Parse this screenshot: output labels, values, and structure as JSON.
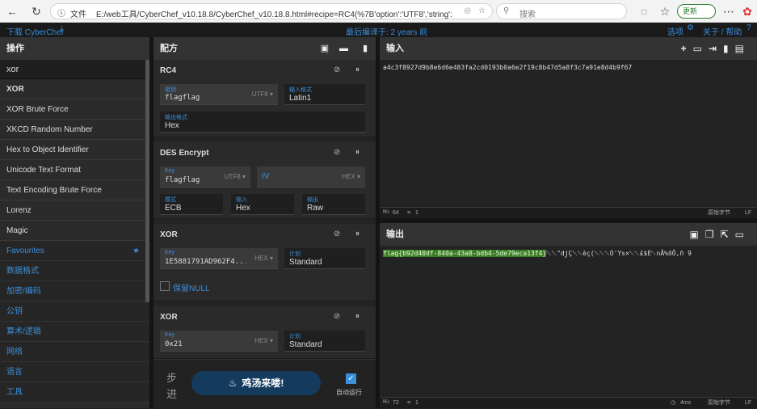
{
  "browser": {
    "file_label": "文件",
    "url": "E:/web工具/CyberChef_v10.18.8/CyberChef_v10.18.8.html#recipe=RC4(%7B'option':'UTF8','string':'flagflag'%7D,'L...",
    "search_placeholder": "搜索",
    "update_label": "更新"
  },
  "banner": {
    "download_label": "下载 CyberChef",
    "last_build": "最后编译于: 2 years 前",
    "options_label": "选项",
    "about_label": "关于 / 帮助"
  },
  "operations": {
    "title": "操作",
    "search_value": "xor",
    "items": [
      "XOR",
      "XOR Brute Force",
      "XKCD Random Number",
      "Hex to Object Identifier",
      "Unicode Text Format",
      "Text Encoding Brute Force",
      "Lorenz",
      "Magic"
    ],
    "categories": [
      "Favourites",
      "数据格式",
      "加密/编码",
      "公钥",
      "算术/逻辑",
      "网络",
      "语言",
      "工具"
    ]
  },
  "recipe": {
    "title": "配方",
    "ops": [
      {
        "name": "RC4",
        "fields": [
          {
            "label": "密钥",
            "value": "flagflag",
            "dropdown": "UTF8"
          },
          {
            "label": "输入格式",
            "value": "Latin1"
          },
          {
            "label": "输出格式",
            "value": "Hex"
          }
        ]
      },
      {
        "name": "DES Encrypt",
        "fields": [
          {
            "label": "Key",
            "value": "flagflag",
            "dropdown": "UTF8"
          },
          {
            "label": "IV",
            "value": "",
            "dropdown": "HEX"
          },
          {
            "label": "模式",
            "value": "ECB"
          },
          {
            "label": "输入",
            "value": "Hex"
          },
          {
            "label": "输出",
            "value": "Raw"
          }
        ]
      },
      {
        "name": "XOR",
        "fields": [
          {
            "label": "Key",
            "value": "1E5881791AD962F4...",
            "dropdown": "HEX"
          },
          {
            "label": "计划",
            "value": "Standard"
          }
        ],
        "checkbox_label": "保留NULL"
      },
      {
        "name": "XOR",
        "fields": [
          {
            "label": "Key",
            "value": "0x21",
            "dropdown": "HEX"
          },
          {
            "label": "计划",
            "value": "Standard"
          }
        ]
      }
    ],
    "step_label_1": "步",
    "step_label_2": "进",
    "bake_label": "鸡汤来喽!",
    "autobake_label": "自动运行"
  },
  "input": {
    "title": "输入",
    "text": "a4c3f8927d9b8e6d6e483fa2cd0193b0a6e2f19c8b47d5a8f3c7a91e8d4b9f67",
    "status_len": "64",
    "status_lines": "1",
    "encoding": "原始字节",
    "eol": "LF"
  },
  "output": {
    "title": "输出",
    "flag": "flag{b92d40df-840a-43a8-bdb4-5de79eca13f4}",
    "garbage": "␀␀\"dj̧Ç␀␀èç(␀␀␀Ò'Ys×␀␀£$Ė␀nÃ%õÕ,ñ   9",
    "status_len": "72",
    "status_lines": "1",
    "time": "4ms",
    "encoding": "原始字节",
    "eol": "LF"
  },
  "colors": {
    "accent": "#3b8fd9",
    "highlight": "#3b7d23",
    "bake": "#143a5e"
  }
}
